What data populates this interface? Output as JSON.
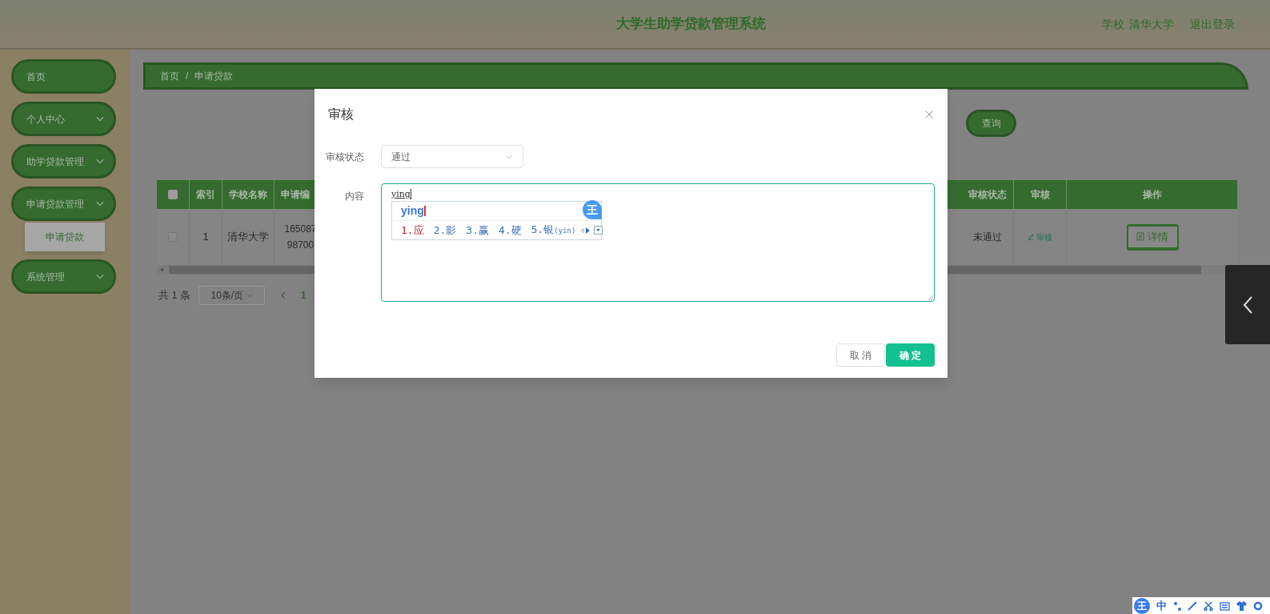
{
  "header": {
    "title": "大学生助学贷款管理系统",
    "school_label": "学校",
    "school": "清华大学",
    "logout": "退出登录"
  },
  "sidebar": {
    "items": [
      {
        "label": "首页",
        "kind": "link"
      },
      {
        "label": "个人中心",
        "kind": "menu"
      },
      {
        "label": "助学贷款管理",
        "kind": "menu"
      },
      {
        "label": "申请贷款管理",
        "kind": "menu",
        "children": [
          {
            "label": "申请贷款",
            "selected": true
          }
        ]
      },
      {
        "label": "系统管理",
        "kind": "menu"
      }
    ]
  },
  "breadcrumb": {
    "items": [
      "首页",
      "申请贷款"
    ],
    "separator": "/"
  },
  "search": {
    "button": "查询"
  },
  "table": {
    "select_all_checked": false,
    "columns": [
      "索引",
      "学校名称",
      "申请编",
      "审核状态",
      "审核",
      "操作"
    ],
    "rows": [
      {
        "checked": false,
        "index": "1",
        "school": "清华大学",
        "number": "165087 98700",
        "status": "未通过",
        "review": "审核",
        "action": "详情"
      }
    ]
  },
  "pagination": {
    "total": "共 1 条",
    "page_size": "10条/页",
    "current": "1"
  },
  "dialog": {
    "title": "审核",
    "status_label": "审核状态",
    "status_value": "通过",
    "content_label": "内容",
    "content_value": "ying",
    "ime": {
      "logo": "王",
      "composition": "ying",
      "candidates": [
        {
          "label": "1.应",
          "selected": true
        },
        {
          "label": "2.影",
          "selected": false
        },
        {
          "label": "3.赢",
          "selected": false
        },
        {
          "label": "4.硬",
          "selected": false
        },
        {
          "label": "5.银",
          "hint": "(yin)",
          "selected": false
        }
      ]
    },
    "cancel": "取 消",
    "confirm": "确 定"
  },
  "ime_toolbar": {
    "logo": "王",
    "mode": "中"
  }
}
